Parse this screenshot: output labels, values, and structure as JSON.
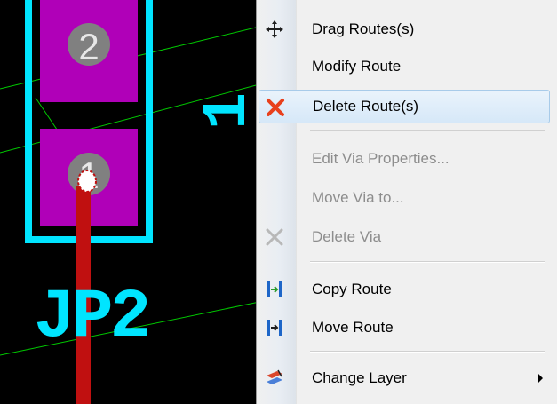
{
  "pcb": {
    "pad_numbers": [
      "2",
      "1"
    ],
    "component_label": "JP2",
    "side_text": "1",
    "colors": {
      "background": "#000000",
      "silkscreen": "#00e5ff",
      "pad": "#b000b8",
      "ratsnest": "#00c800",
      "trace": "#c01010"
    }
  },
  "context_menu": {
    "items": [
      {
        "label": "Drag Routes(s)",
        "icon": "move-arrows-icon",
        "enabled": true
      },
      {
        "label": "Modify Route",
        "icon": "",
        "enabled": true
      },
      {
        "label": "Delete Route(s)",
        "icon": "red-x-icon",
        "enabled": true,
        "highlighted": true
      },
      {
        "label": "Edit Via Properties...",
        "icon": "",
        "enabled": false
      },
      {
        "label": "Move Via to...",
        "icon": "",
        "enabled": false
      },
      {
        "label": "Delete Via",
        "icon": "grey-x-icon",
        "enabled": false
      },
      {
        "label": "Copy Route",
        "icon": "copy-route-icon",
        "enabled": true
      },
      {
        "label": "Move Route",
        "icon": "move-route-icon",
        "enabled": true
      },
      {
        "label": "Change Layer",
        "icon": "change-layer-icon",
        "enabled": true,
        "has_submenu": true
      }
    ]
  }
}
